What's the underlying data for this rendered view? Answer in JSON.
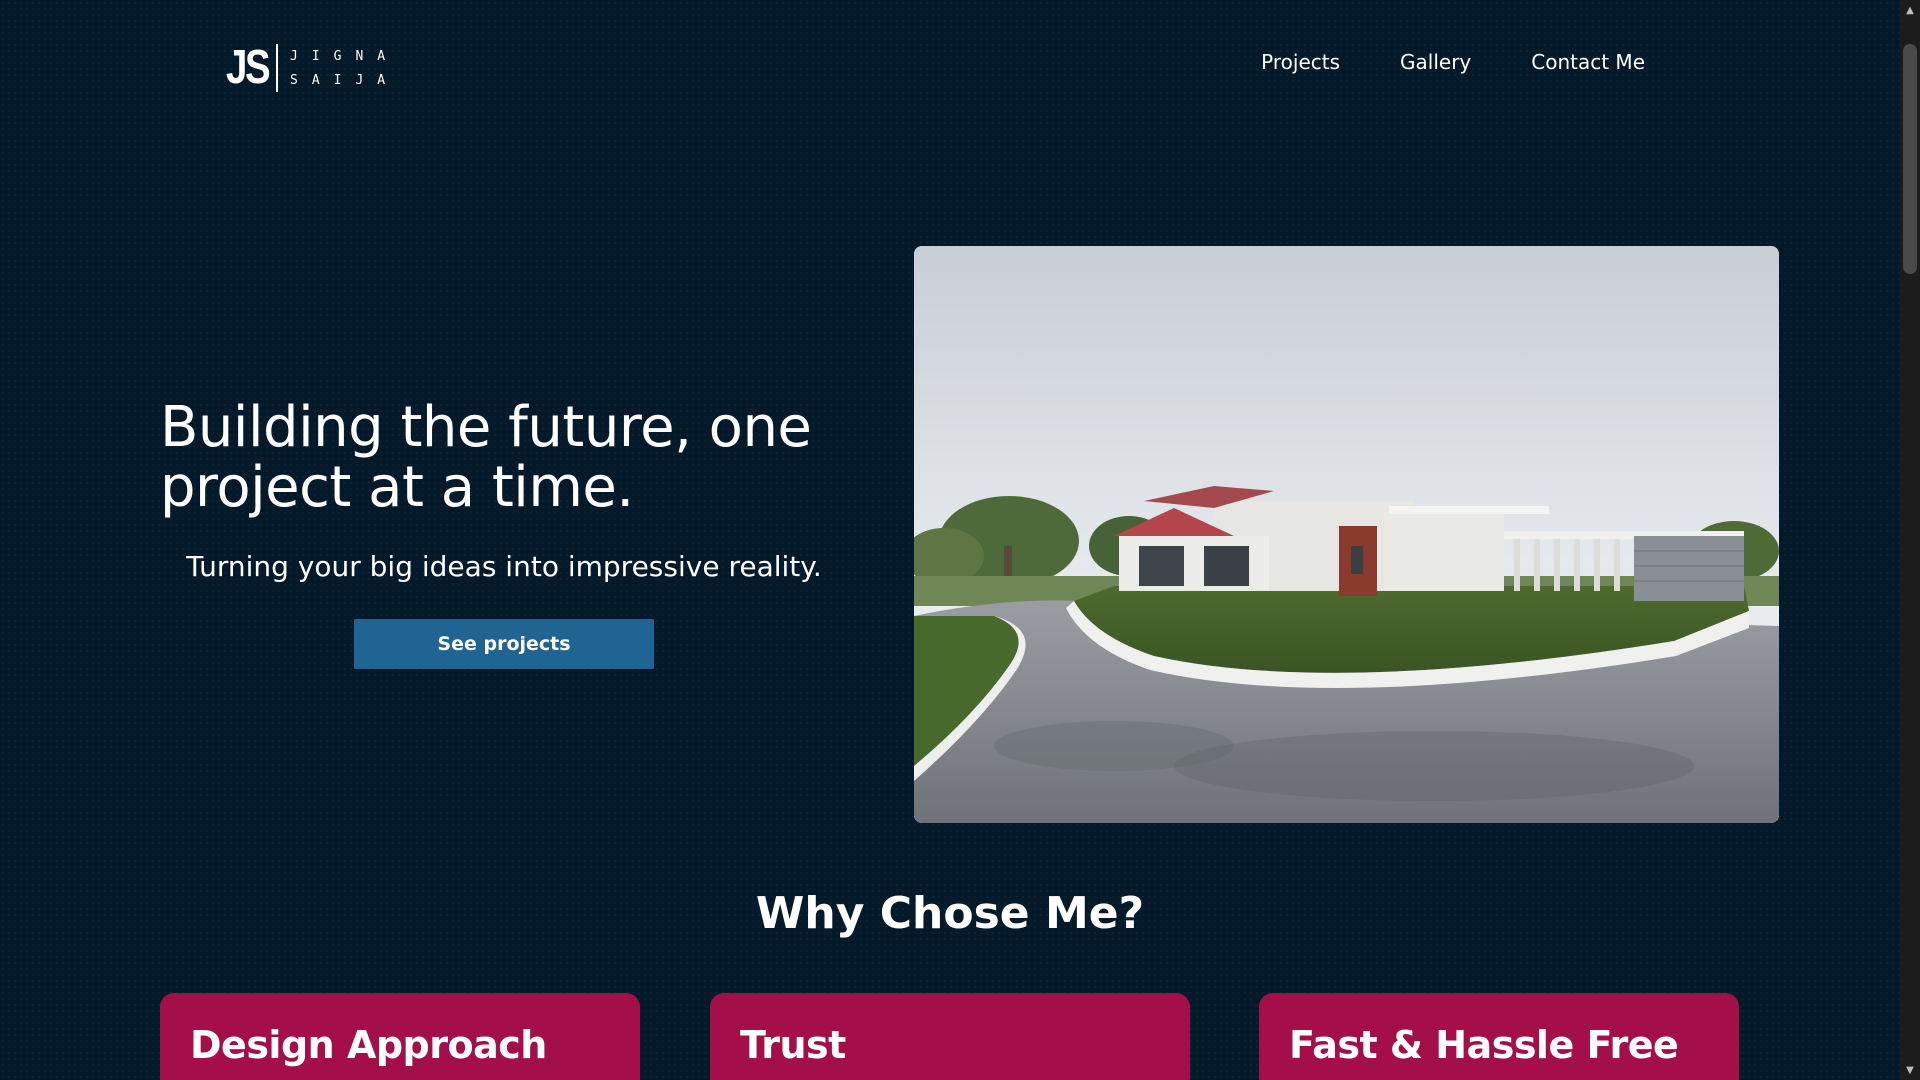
{
  "header": {
    "logo": {
      "mark": "JS",
      "line1": "JIGNA",
      "line2": "SAIJA"
    },
    "nav": [
      {
        "label": "Projects"
      },
      {
        "label": "Gallery"
      },
      {
        "label": "Contact Me"
      }
    ]
  },
  "hero": {
    "title": "Building the future, one project at a time.",
    "subtitle": "Turning your big ideas into impressive reality.",
    "cta_label": "See projects",
    "image_icon": "house-render-photo"
  },
  "why": {
    "title": "Why Chose Me?",
    "cards": [
      {
        "title": "Design Approach"
      },
      {
        "title": "Trust"
      },
      {
        "title": "Fast & Hassle Free"
      }
    ]
  },
  "colors": {
    "background": "#041a2a",
    "cta": "#1f6493",
    "card": "#a40f4a"
  },
  "scrollbar": {
    "up_icon": "scroll-up-arrow-icon",
    "down_icon": "scroll-down-arrow-icon"
  }
}
